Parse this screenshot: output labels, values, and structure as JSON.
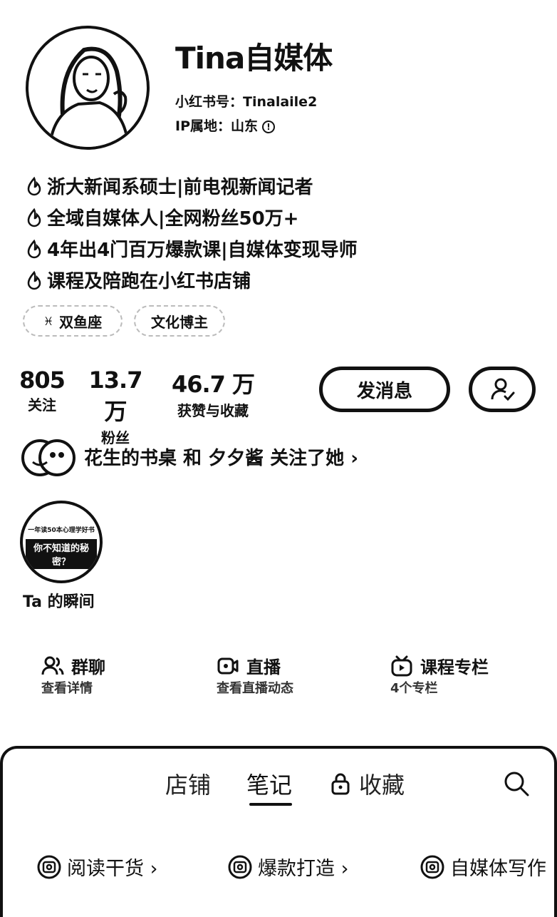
{
  "profile": {
    "name": "Tina自媒体",
    "id_text": "小红书号：Tinalaile2",
    "ip_text": "IP属地：山东",
    "info_icon": "info-icon"
  },
  "bio": [
    "浙大新闻系硕士|前电视新闻记者",
    "全域自媒体人|全网粉丝50万+",
    "4年出4门百万爆款课|自媒体变现导师",
    "课程及陪跑在小红书店铺"
  ],
  "tags": [
    {
      "label": "双鱼座",
      "icon": "pisces-icon"
    },
    {
      "label": "文化博主"
    }
  ],
  "stats": [
    {
      "value": "805",
      "label": "关注"
    },
    {
      "value": "13.7 万",
      "label": "粉丝"
    },
    {
      "value": "46.7 万",
      "label": "获赞与收藏"
    }
  ],
  "actions": {
    "message": "发消息",
    "follow_icon": "user-check-icon"
  },
  "followed_by": "花生的书桌 和 夕夕酱 关注了她 ›",
  "moment": {
    "label": "Ta 的瞬间",
    "thumb_text_1": "一年读50本心理学好书",
    "thumb_text_2": "你不知道的秘密？"
  },
  "features": [
    {
      "title": "群聊",
      "sub": "查看详情",
      "icon": "group-chat-icon"
    },
    {
      "title": "直播",
      "sub": "查看直播动态",
      "icon": "live-icon"
    },
    {
      "title": "课程专栏",
      "sub": "4个专栏",
      "icon": "course-icon"
    }
  ],
  "tabs": [
    "店铺",
    "笔记",
    "收藏"
  ],
  "active_tab": "笔记",
  "chips": [
    {
      "label": "阅读干货 ›"
    },
    {
      "label": "爆款打造 ›"
    },
    {
      "label": "自媒体写作"
    }
  ],
  "colors": {
    "text": "#111111",
    "background": "#ffffff"
  }
}
